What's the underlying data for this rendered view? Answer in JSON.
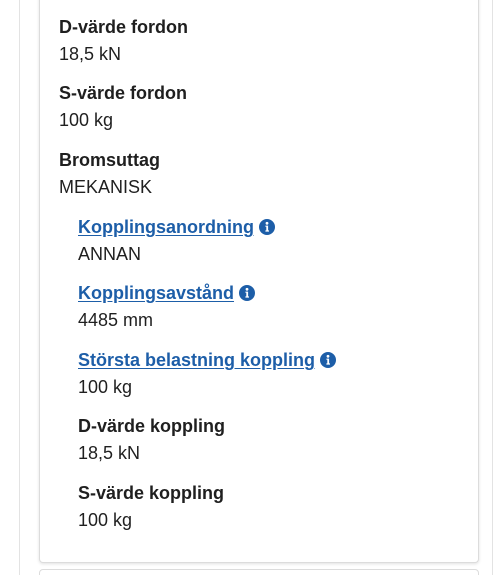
{
  "fields": [
    {
      "label": "D-värde fordon",
      "value": "18,5 kN"
    },
    {
      "label": "S-värde fordon",
      "value": "100 kg"
    },
    {
      "label": "Bromsuttag",
      "value": "MEKANISK"
    },
    {
      "label": "Kopplingsanordning",
      "value": "ANNAN"
    },
    {
      "label": "Kopplingsavstånd",
      "value": "4485 mm"
    },
    {
      "label": "Största belastning koppling",
      "value": "100 kg"
    },
    {
      "label": "D-värde koppling",
      "value": "18,5 kN"
    },
    {
      "label": "S-värde koppling",
      "value": "100 kg"
    }
  ],
  "colors": {
    "link": "#1d5ea8",
    "info_icon": "#1d5ea8",
    "text": "#1f1f1f"
  },
  "icons": {
    "info": "info-circle-icon"
  }
}
